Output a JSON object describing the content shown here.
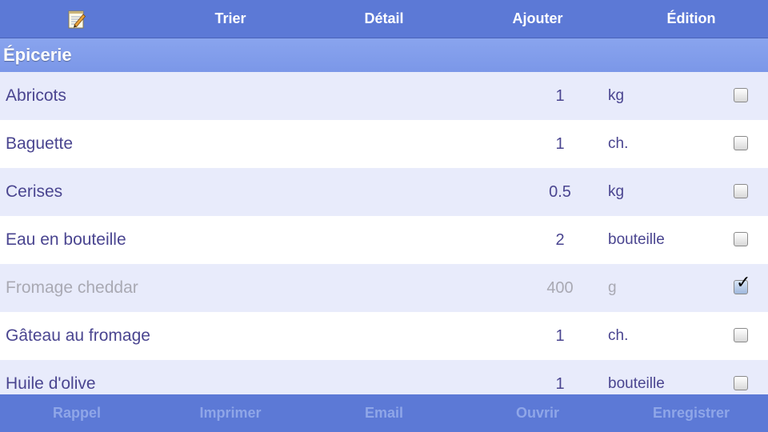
{
  "toolbar": {
    "icon": "notepad-pencil-icon",
    "buttons": [
      "Trier",
      "Détail",
      "Ajouter",
      "Édition"
    ]
  },
  "section": {
    "title": "Épicerie"
  },
  "items": [
    {
      "name": "Abricots",
      "qty": "1",
      "unit": "kg",
      "checked": false
    },
    {
      "name": "Baguette",
      "qty": "1",
      "unit": "ch.",
      "checked": false
    },
    {
      "name": "Cerises",
      "qty": "0.5",
      "unit": "kg",
      "checked": false
    },
    {
      "name": "Eau en bouteille",
      "qty": "2",
      "unit": "bouteille",
      "checked": false
    },
    {
      "name": "Fromage cheddar",
      "qty": "400",
      "unit": "g",
      "checked": true
    },
    {
      "name": "Gâteau au fromage",
      "qty": "1",
      "unit": "ch.",
      "checked": false
    },
    {
      "name": "Huile d'olive",
      "qty": "1",
      "unit": "bouteille",
      "checked": false
    }
  ],
  "bottombar": {
    "buttons": [
      "Rappel",
      "Imprimer",
      "Email",
      "Ouvrir",
      "Enregistrer"
    ]
  },
  "colors": {
    "bar": "#5c79d6",
    "section": "#7b97e8",
    "row_alt": "#e8ebfb",
    "text": "#4a4590",
    "text_done": "#a9a9b3",
    "bottom_text_disabled": "#8fa6e8"
  }
}
